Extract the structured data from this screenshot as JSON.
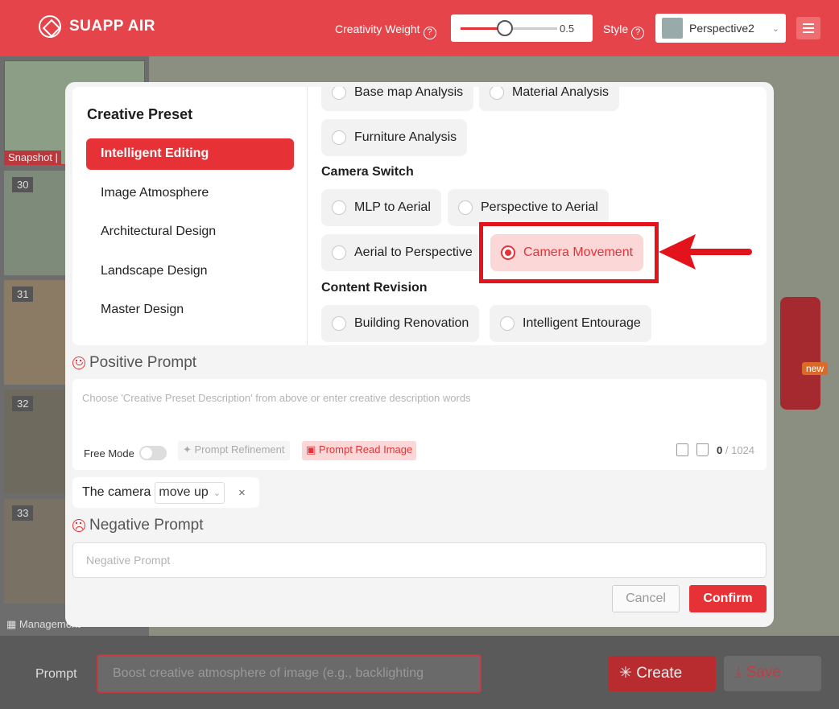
{
  "topbar": {
    "brand": "SUAPP AIR",
    "creativity_label": "Creativity Weight",
    "creativity_value": "0.5",
    "creativity_fraction": 0.5,
    "style_label": "Style",
    "style_value": "Perspective2",
    "help_glyph": "?"
  },
  "sidebar": {
    "snapshot_label": "Snapshot |",
    "thumbs": [
      "30",
      "31",
      "32",
      "33"
    ],
    "management_label": "Management"
  },
  "map": {
    "new_badge": "new"
  },
  "bottombar": {
    "prompt_label": "Prompt",
    "prompt_placeholder": "Boost creative atmosphere of image (e.g., backlighting",
    "create_label": "Create",
    "save_label": "Save"
  },
  "modal": {
    "preset_title": "Creative Preset",
    "categories": [
      "Intelligent Editing",
      "Image Atmosphere",
      "Architectural Design",
      "Landscape Design",
      "Master Design"
    ],
    "analysis_options": [
      "Base map Analysis",
      "Material Analysis",
      "Furniture Analysis"
    ],
    "camera_switch_title": "Camera Switch",
    "camera_options": [
      "MLP to Aerial",
      "Perspective to Aerial",
      "Aerial to Perspective",
      "Camera Movement"
    ],
    "content_revision_title": "Content Revision",
    "content_options": [
      "Building Renovation",
      "Intelligent Entourage"
    ],
    "positive_prompt_title": "Positive Prompt",
    "positive_placeholder": "Choose 'Creative Preset Description' from above or enter creative description words",
    "free_mode_label": "Free Mode",
    "prompt_refinement_label": "Prompt Refinement",
    "prompt_read_image_label": "Prompt Read Image",
    "counter_current": "0",
    "counter_sep": "/",
    "counter_max": "1024",
    "chip_prefix": "The camera",
    "chip_select_value": "move up",
    "chip_close": "×",
    "negative_prompt_title": "Negative Prompt",
    "negative_placeholder": "Negative Prompt",
    "cancel_label": "Cancel",
    "confirm_label": "Confirm"
  },
  "colors": {
    "accent": "#e63236",
    "selected_bg": "#fbd7d8",
    "highlight": "#e3131b"
  }
}
